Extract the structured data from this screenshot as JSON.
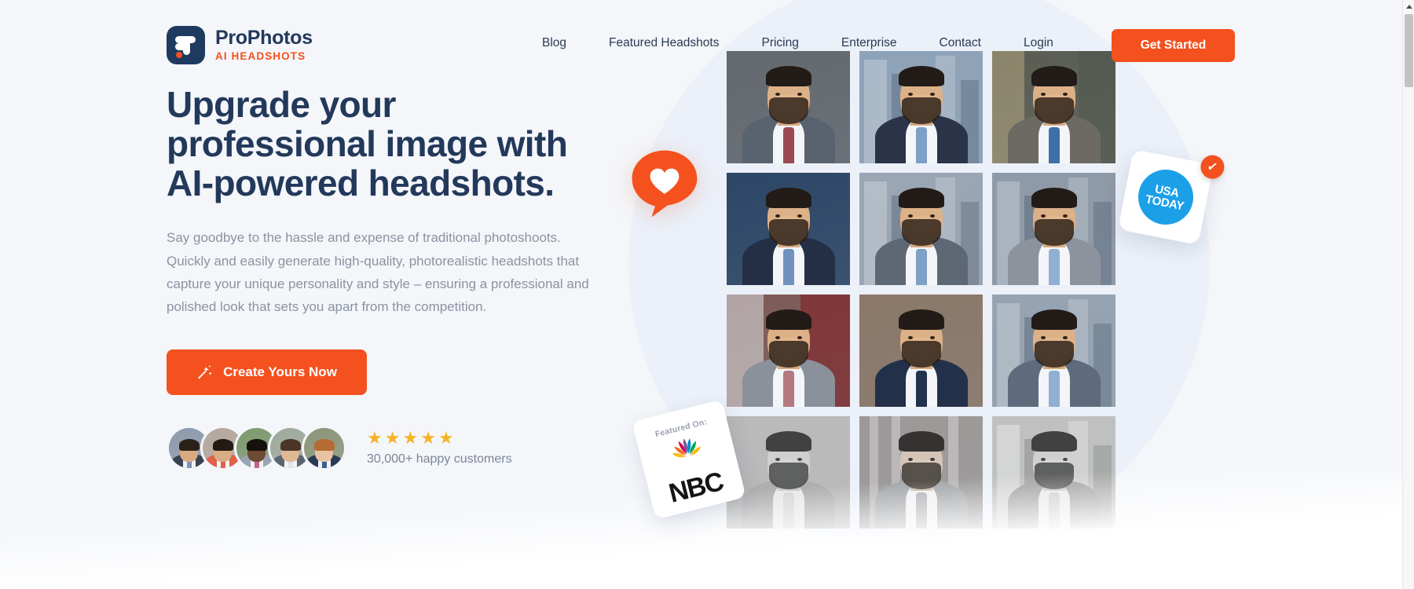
{
  "brand": {
    "name": "ProPhotos",
    "tagline": "AI HEADSHOTS",
    "logo_icon": "prophotos-logo-icon"
  },
  "nav": {
    "items": [
      {
        "label": "Blog"
      },
      {
        "label": "Featured Headshots"
      },
      {
        "label": "Pricing"
      },
      {
        "label": "Enterprise"
      },
      {
        "label": "Contact"
      },
      {
        "label": "Login"
      }
    ],
    "cta_label": "Get Started"
  },
  "hero": {
    "title_line_1": "Upgrade your",
    "title_line_2": "professional image with",
    "title_line_3": "AI-powered headshots.",
    "paragraph": "Say goodbye to the hassle and expense of traditional photoshoots. Quickly and easily generate high-quality, photorealistic headshots that capture your unique personality and style – ensuring a professional and polished look that sets you apart from the competition.",
    "cta_label": "Create Yours Now",
    "cta_icon": "magic-wand-icon"
  },
  "social_proof": {
    "stars": "★★★★★",
    "star_count": 5,
    "rating_text": "30,000+ happy customers",
    "avatars": [
      {
        "name": "avatar-customer-1",
        "bg": "#8d9bac",
        "skin": "#d8ab82",
        "hair": "#2b2119",
        "suit": "#37414f",
        "tie": "#7d93b5"
      },
      {
        "name": "avatar-customer-2",
        "bg": "#b4a79d",
        "skin": "#d9ac85",
        "hair": "#241a14",
        "suit": "#e0604a",
        "tie": "#e0604a"
      },
      {
        "name": "avatar-customer-3",
        "bg": "#7e9a6e",
        "skin": "#6d4a32",
        "hair": "#17110c",
        "suit": "#9aa4b2",
        "tie": "#c4608c"
      },
      {
        "name": "avatar-customer-4",
        "bg": "#9fa99c",
        "skin": "#e0b894",
        "hair": "#4a3526",
        "suit": "#5b6472",
        "tie": "#dfe4ea"
      },
      {
        "name": "avatar-customer-5",
        "bg": "#8a9577",
        "skin": "#e8c3a2",
        "hair": "#b56b34",
        "suit": "#2a3a55",
        "tie": "#3a5f8f"
      }
    ]
  },
  "badges": {
    "heart_bubble": {
      "icon": "heart-speech-bubble-icon",
      "color": "#f4511e"
    },
    "nbc_card": {
      "label": "Featured On:",
      "brand": "NBC",
      "icon": "nbc-peacock-icon"
    },
    "usa_today_card": {
      "line_1": "USA",
      "line_2": "TODAY",
      "check_icon": "verified-check-icon",
      "color": "#1ba0e8"
    }
  },
  "photo_grid": {
    "label": "ai-headshot-samples",
    "photos": [
      {
        "name": "headshot-1",
        "bg": "#64696f",
        "suit": "#59636f",
        "tie": "#9c4a52",
        "style": "studio-gray",
        "dim": "none"
      },
      {
        "name": "headshot-2",
        "bg": "#8fa3b8",
        "suit": "#2a3348",
        "tie": "#7ea0c6",
        "style": "city-skyline",
        "dim": "none"
      },
      {
        "name": "headshot-3",
        "bg": "#5a5d52",
        "suit": "#6d6a64",
        "tie": "#3f6fa8",
        "style": "office-window",
        "dim": "none"
      },
      {
        "name": "headshot-4",
        "bg": "#2c4666",
        "suit": "#242f45",
        "tie": "#6f93bd",
        "style": "navy-backdrop",
        "dim": "none"
      },
      {
        "name": "headshot-5",
        "bg": "#9aa6b4",
        "suit": "#5e6874",
        "tie": "#7ea0c6",
        "style": "city-skyline",
        "dim": "none"
      },
      {
        "name": "headshot-6",
        "bg": "#8e9aa8",
        "suit": "#8c939c",
        "tie": "#8fb0d3",
        "style": "city-skyline",
        "dim": "none"
      },
      {
        "name": "headshot-7",
        "bg": "#7d5b57",
        "suit": "#8b919b",
        "tie": "#b4787e",
        "style": "red-backdrop",
        "dim": "none"
      },
      {
        "name": "headshot-8",
        "bg": "#8b7868",
        "suit": "#23304a",
        "tie": "#22314c",
        "style": "warm-studio",
        "dim": "none"
      },
      {
        "name": "headshot-9",
        "bg": "#95a3b2",
        "suit": "#5d6b7d",
        "tie": "#8fb0d3",
        "style": "bokeh-city",
        "dim": "none"
      },
      {
        "name": "headshot-10",
        "bg": "#9aa0a6",
        "suit": "#8d949c",
        "tie": "#b9bfc6",
        "style": "soft-gray",
        "dim": "dim"
      },
      {
        "name": "headshot-11",
        "bg": "#8d8781",
        "suit": "#8f959d",
        "tie": "#9aa1a9",
        "style": "lobby",
        "dim": "dim2"
      },
      {
        "name": "headshot-12",
        "bg": "#a2a7ad",
        "suit": "#7f858d",
        "tie": "#aeb4bb",
        "style": "city-skyline",
        "dim": "dim"
      }
    ]
  },
  "scrollbar": {
    "name": "page-scrollbar",
    "arrow_icon": "chevron-up-icon"
  },
  "colors": {
    "accent": "#f4511e",
    "heading": "#23395b",
    "body_text": "#8b93a1",
    "page_bg": "#f4f6fa",
    "star": "#f5b324",
    "usa_blue": "#1ba0e8"
  }
}
